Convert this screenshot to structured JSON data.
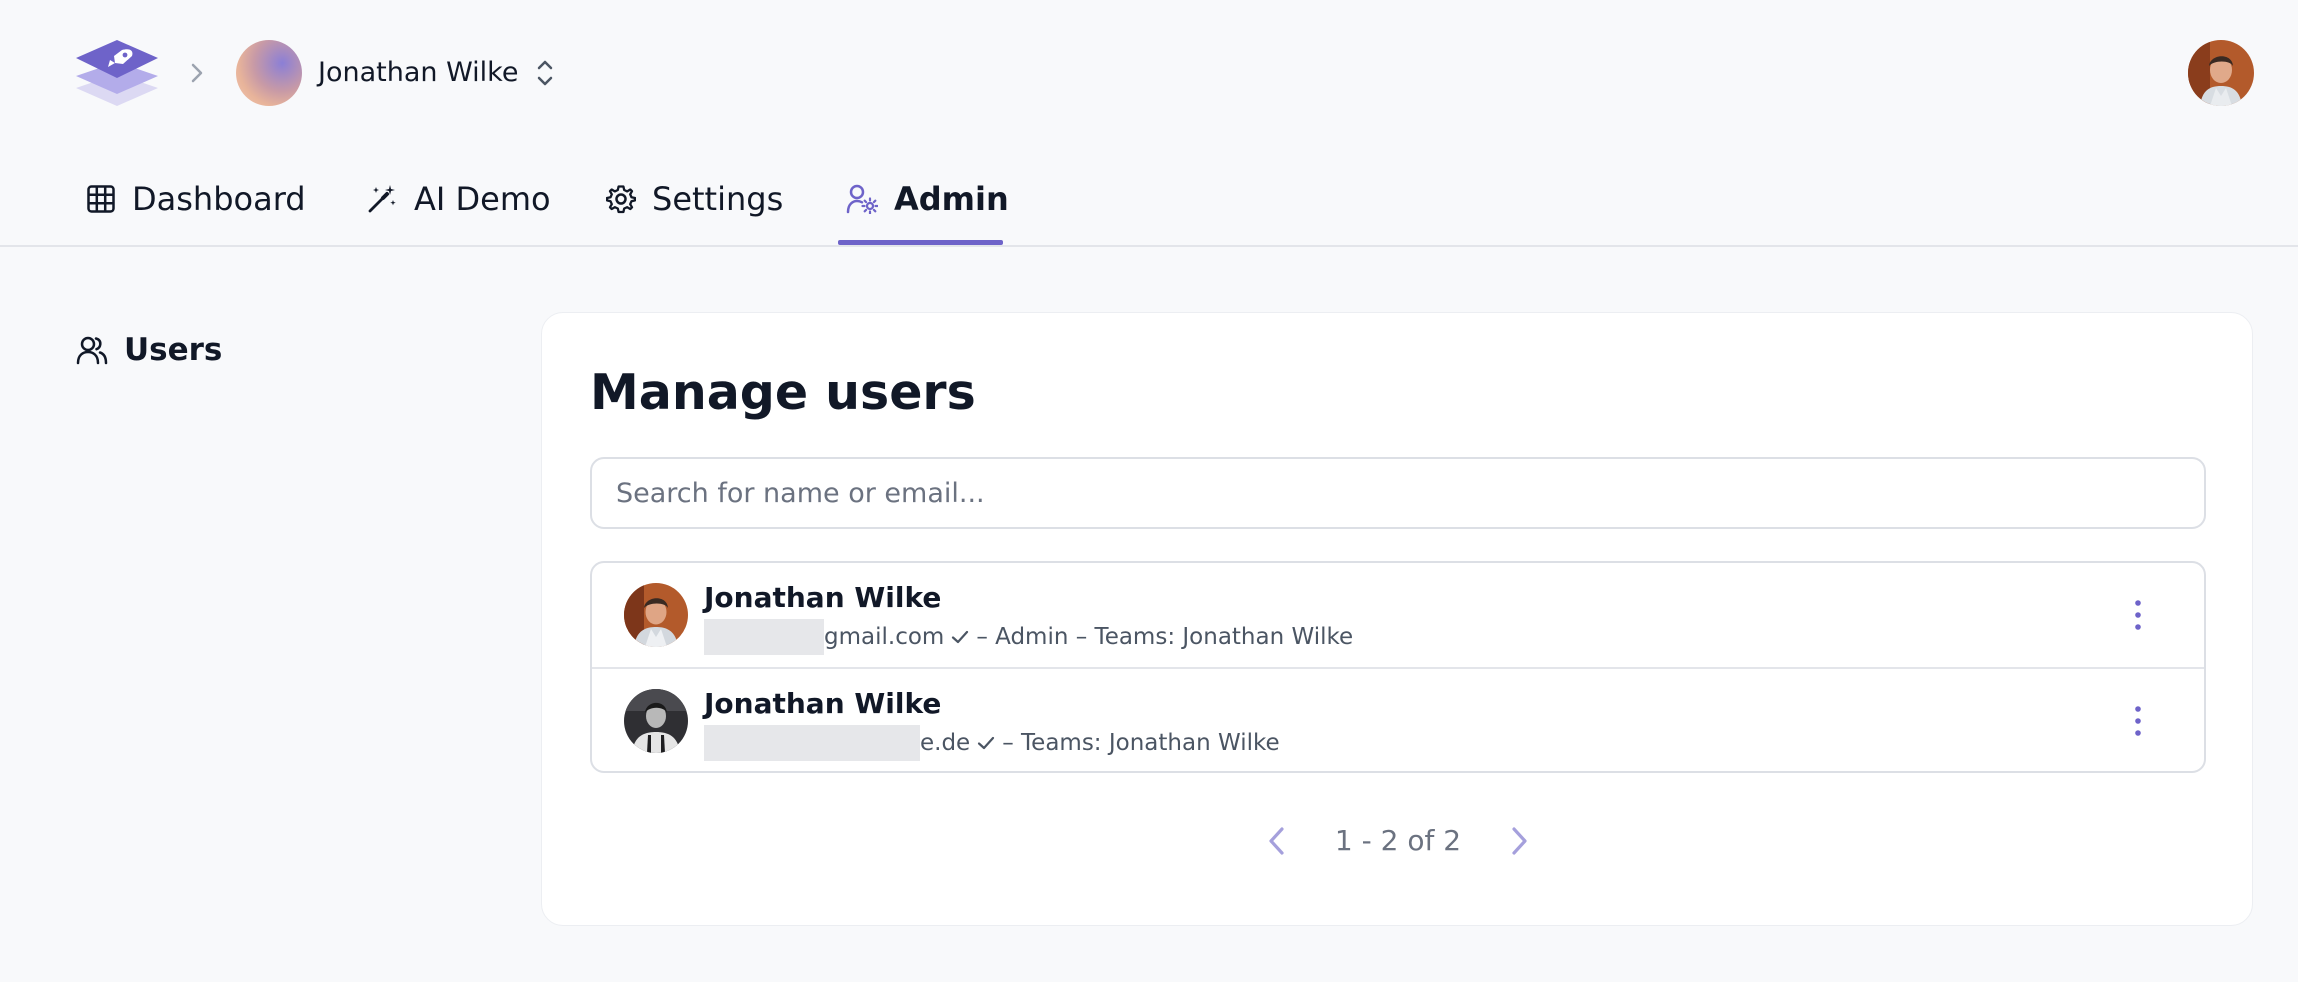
{
  "header": {
    "logo_icon": "rocket-stack-logo",
    "breadcrumb_icon": "chevron-right-icon",
    "team_name": "Jonathan Wilke",
    "switch_icon": "chevrons-up-down-icon"
  },
  "tabs": [
    {
      "label": "Dashboard",
      "icon": "grid-icon",
      "active": false
    },
    {
      "label": "AI Demo",
      "icon": "magic-wand-icon",
      "active": false
    },
    {
      "label": "Settings",
      "icon": "gear-icon",
      "active": false
    },
    {
      "label": "Admin",
      "icon": "user-cog-icon",
      "active": true
    }
  ],
  "sidebar": {
    "items": [
      {
        "label": "Users",
        "icon": "users-icon",
        "active": true
      }
    ]
  },
  "main": {
    "title": "Manage users",
    "search_placeholder": "Search for name or email...",
    "users": [
      {
        "name": "Jonathan Wilke",
        "email_visible": "gmail.com",
        "verified_icon": "check-icon",
        "details": "– Admin – Teams: Jonathan Wilke"
      },
      {
        "name": "Jonathan Wilke",
        "email_visible": "e.de",
        "verified_icon": "check-icon",
        "details": "– Teams: Jonathan Wilke"
      }
    ],
    "pagination": {
      "label": "1 - 2 of 2"
    }
  },
  "colors": {
    "accent": "#6e63c9",
    "background": "#f8f9fb",
    "card": "#ffffff",
    "border": "#dcdfe5",
    "muted_text": "#6b7280"
  }
}
